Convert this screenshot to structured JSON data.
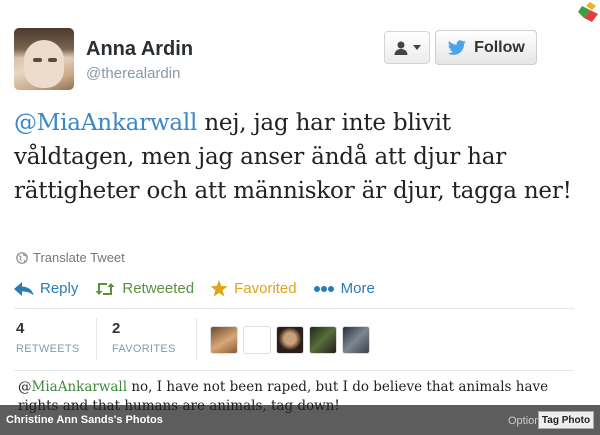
{
  "user": {
    "name": "Anna Ardin",
    "handle": "@therealardin"
  },
  "buttons": {
    "follow_label": "Follow"
  },
  "tweet": {
    "mention": "@MiaAnkarwall",
    "text": " nej, jag har inte blivit våldtagen, men jag anser ändå att djur har rättigheter och att människor är djur, tagga ner!"
  },
  "translate_label": "Translate Tweet",
  "actions": {
    "reply": "Reply",
    "retweeted": "Retweeted",
    "favorited": "Favorited",
    "more": "More"
  },
  "stats": {
    "retweets_count": "4",
    "retweets_label": "RETWEETS",
    "favorites_count": "2",
    "favorites_label": "FAVORITES"
  },
  "translation": {
    "at": "@",
    "mention": "MiaAnkarwall",
    "text": " no, I have not been raped, but I do believe that animals have rights and that humans are animals, tag down!"
  },
  "photo_bar": {
    "caption": "Christine Ann Sands's Photos",
    "options": "Options",
    "tag_photo": "Tag Photo"
  },
  "colors": {
    "mention_blue": "#3a86c8",
    "retweeted_green": "#5c913b",
    "favorited_gold": "#e0a31b",
    "link_blue": "#2b7bb9"
  },
  "icons": [
    "user-menu-icon",
    "bird-icon",
    "globe-icon",
    "reply-arrow-icon",
    "retweet-icon",
    "star-icon",
    "more-dots-icon"
  ]
}
